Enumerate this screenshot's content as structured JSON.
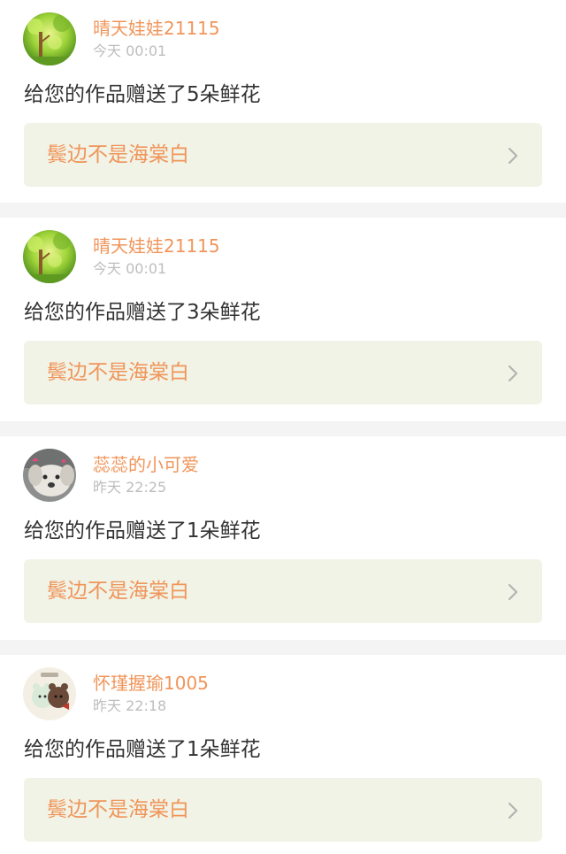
{
  "notifications": [
    {
      "user_name": "晴天娃娃21115",
      "time": "今天 00:01",
      "message": "给您的作品赠送了5朵鲜花",
      "work_title": "鬓边不是海棠白",
      "avatar_icon": "forest-tree-avatar"
    },
    {
      "user_name": "晴天娃娃21115",
      "time": "今天 00:01",
      "message": "给您的作品赠送了3朵鲜花",
      "work_title": "鬓边不是海棠白",
      "avatar_icon": "forest-tree-avatar"
    },
    {
      "user_name": "蕊蕊的小可爱",
      "time": "昨天 22:25",
      "message": "给您的作品赠送了1朵鲜花",
      "work_title": "鬓边不是海棠白",
      "avatar_icon": "puppy-avatar"
    },
    {
      "user_name": "怀瑾握瑜1005",
      "time": "昨天 22:18",
      "message": "给您的作品赠送了1朵鲜花",
      "work_title": "鬓边不是海棠白",
      "avatar_icon": "cartoon-bears-avatar"
    }
  ],
  "colors": {
    "accent": "#f0955a",
    "muted": "#bdbdbd",
    "link_background": "#f1f3e6",
    "page_background": "#f4f4f4"
  }
}
